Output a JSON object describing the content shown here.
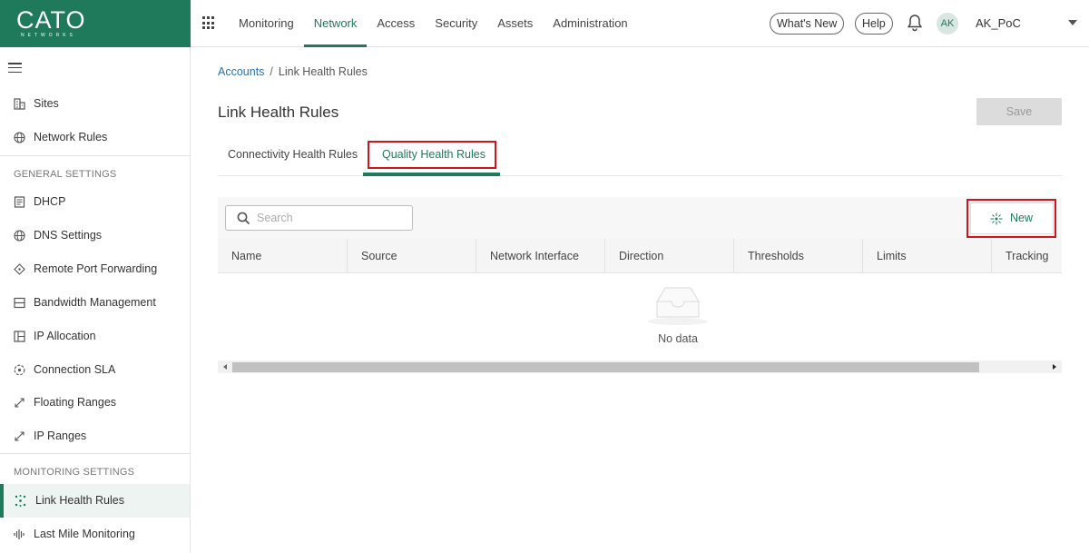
{
  "brand": {
    "name": "CATO",
    "tagline": "NETWORKS",
    "color": "#1e7a5a"
  },
  "topnav": {
    "items": [
      {
        "label": "Monitoring"
      },
      {
        "label": "Network",
        "active": true
      },
      {
        "label": "Access"
      },
      {
        "label": "Security"
      },
      {
        "label": "Assets"
      },
      {
        "label": "Administration"
      }
    ],
    "whats_new": "What's New",
    "help": "Help",
    "avatar_initials": "AK",
    "account_name": "AK_PoC"
  },
  "sidebar": {
    "items_top": [
      {
        "label": "Sites",
        "icon": "building-icon"
      },
      {
        "label": "Network Rules",
        "icon": "globe-icon"
      }
    ],
    "general_header": "GENERAL SETTINGS",
    "general_items": [
      {
        "label": "DHCP",
        "icon": "document-icon"
      },
      {
        "label": "DNS Settings",
        "icon": "globe-icon"
      },
      {
        "label": "Remote Port Forwarding",
        "icon": "diamond-icon"
      },
      {
        "label": "Bandwidth Management",
        "icon": "bandwidth-icon"
      },
      {
        "label": "IP Allocation",
        "icon": "grid-icon"
      },
      {
        "label": "Connection SLA",
        "icon": "target-icon"
      },
      {
        "label": "Floating Ranges",
        "icon": "expand-arrows-icon"
      },
      {
        "label": "IP Ranges",
        "icon": "expand-arrows-icon"
      }
    ],
    "monitoring_header": "MONITORING SETTINGS",
    "monitoring_items": [
      {
        "label": "Link Health Rules",
        "icon": "link-health-icon",
        "active": true
      },
      {
        "label": "Last Mile Monitoring",
        "icon": "waveform-icon"
      }
    ]
  },
  "breadcrumb": {
    "root": "Accounts",
    "separator": "/",
    "current": "Link Health Rules"
  },
  "page": {
    "title": "Link Health Rules",
    "save_label": "Save"
  },
  "tabs": [
    {
      "label": "Connectivity Health Rules"
    },
    {
      "label": "Quality Health Rules",
      "active": true
    }
  ],
  "toolbar": {
    "search_placeholder": "Search",
    "search_value": "",
    "new_label": "New"
  },
  "table": {
    "columns": [
      "Name",
      "Source",
      "Network Interface",
      "Direction",
      "Thresholds",
      "Limits",
      "Tracking"
    ],
    "rows": [],
    "empty_text": "No data"
  },
  "highlight_color": "#d0141c"
}
